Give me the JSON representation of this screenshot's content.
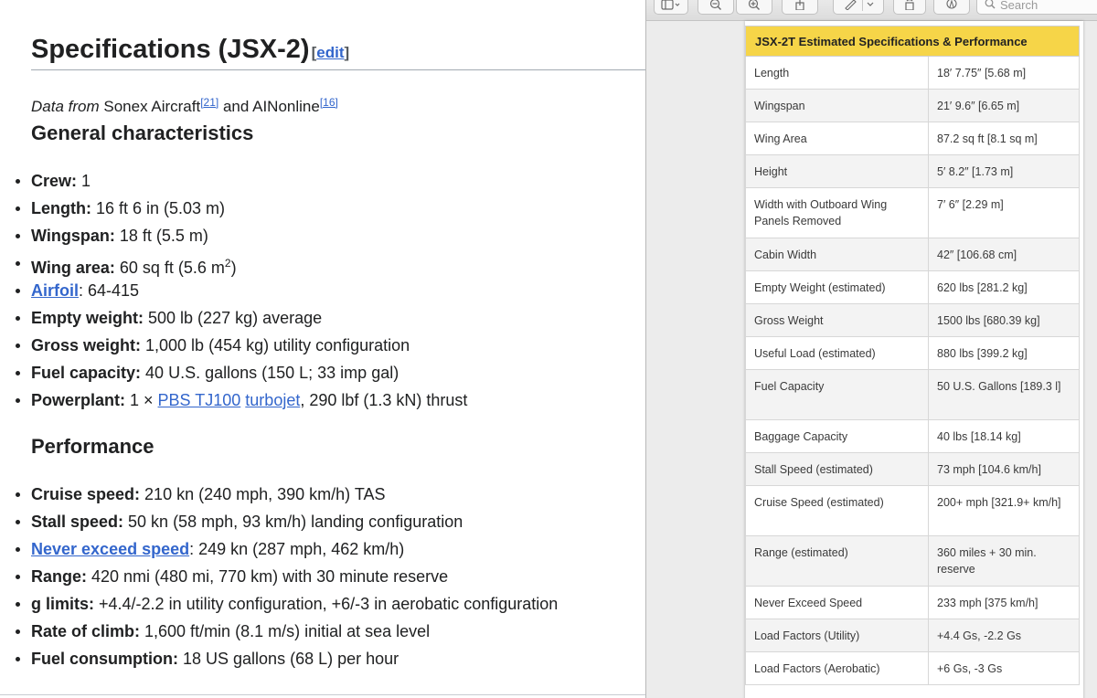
{
  "wiki": {
    "heading": "Specifications (JSX-2)",
    "edit_open": "[",
    "edit_label": "edit",
    "edit_close": "]",
    "source": {
      "prefix": "Data from",
      "src1": "Sonex Aircraft",
      "ref1": "[21]",
      "and": "and",
      "src2": "AINonline",
      "ref2": "[16]"
    },
    "general_heading": "General characteristics",
    "general": [
      {
        "label": "Crew:",
        "value": " 1"
      },
      {
        "label": "Length:",
        "value": " 16 ft 6 in (5.03 m)"
      },
      {
        "label": "Wingspan:",
        "value": " 18 ft (5.5 m)"
      },
      {
        "label": "Wing area:",
        "value": " 60 sq ft (5.6 m",
        "sup": "2",
        "tail": ")"
      },
      {
        "label": "Airfoil",
        "value": ": 64-415"
      },
      {
        "label": "Empty weight:",
        "value": " 500 lb (227 kg) average"
      },
      {
        "label": "Gross weight:",
        "value": " 1,000 lb (454 kg) utility configuration"
      },
      {
        "label": "Fuel capacity:",
        "value": " 40 U.S. gallons (150 L; 33 imp gal)"
      },
      {
        "label": "Powerplant:",
        "value_a": " 1 × ",
        "link1": "PBS TJ100",
        "space": " ",
        "link2": "turbojet",
        "value_b": ", 290 lbf (1.3 kN) thrust"
      }
    ],
    "performance_heading": "Performance",
    "performance": [
      {
        "label": "Cruise speed:",
        "value": " 210 kn (240 mph, 390 km/h) TAS"
      },
      {
        "label": "Stall speed:",
        "value": " 50 kn (58 mph, 93 km/h) landing configuration"
      },
      {
        "label": "Never exceed speed",
        "value": ": 249 kn (287 mph, 462 km/h)"
      },
      {
        "label": "Range:",
        "value": " 420 nmi (480 mi, 770 km) with 30 minute reserve"
      },
      {
        "label": "g limits:",
        "value": " +4.4/-2.2 in utility configuration, +6/-3 in aerobatic configuration"
      },
      {
        "label": "Rate of climb:",
        "value": " 1,600 ft/min (8.1 m/s) initial at sea level"
      },
      {
        "label": "Fuel consumption:",
        "value": " 18 US gallons (68 L) per hour"
      }
    ]
  },
  "viewer": {
    "search_placeholder": "Search",
    "table_title": "JSX-2T Estimated Specifications & Performance",
    "header_color": "#f6d548",
    "rows": [
      {
        "k": "Length",
        "v": "18′ 7.75″ [5.68 m]"
      },
      {
        "k": "Wingspan",
        "v": "21′ 9.6″ [6.65 m]"
      },
      {
        "k": "Wing Area",
        "v": "87.2 sq ft [8.1 sq m]"
      },
      {
        "k": "Height",
        "v": "5′ 8.2″ [1.73 m]"
      },
      {
        "k": "Width with Outboard Wing Panels Removed",
        "v": "7′ 6″ [2.29 m]"
      },
      {
        "k": "Cabin Width",
        "v": "42″ [106.68 cm]"
      },
      {
        "k": "Empty Weight (estimated)",
        "v": "620 lbs [281.2 kg]"
      },
      {
        "k": "Gross Weight",
        "v": "1500 lbs [680.39 kg]"
      },
      {
        "k": "Useful Load (estimated)",
        "v": "880 lbs [399.2 kg]"
      },
      {
        "k": "Fuel Capacity",
        "v": "50 U.S. Gallons [189.3 l]"
      },
      {
        "k": "Baggage Capacity",
        "v": "40 lbs [18.14 kg]"
      },
      {
        "k": "Stall Speed (estimated)",
        "v": "73 mph [104.6 km/h]"
      },
      {
        "k": "Cruise Speed (estimated)",
        "v": "200+ mph [321.9+ km/h]"
      },
      {
        "k": "Range (estimated)",
        "v": "360 miles + 30 min. reserve"
      },
      {
        "k": "Never Exceed Speed",
        "v": "233 mph [375 km/h]"
      },
      {
        "k": "Load Factors (Utility)",
        "v": "+4.4 Gs, -2.2 Gs"
      },
      {
        "k": "Load Factors (Aerobatic)",
        "v": "+6 Gs, -3 Gs"
      }
    ]
  }
}
